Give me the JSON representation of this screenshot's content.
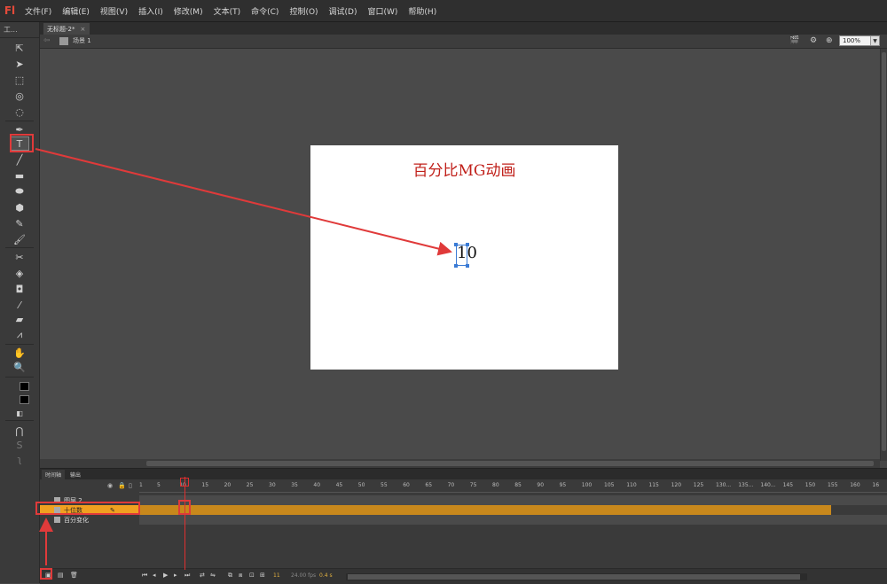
{
  "app": {
    "logo": "Fl"
  },
  "menu": [
    "文件(F)",
    "编辑(E)",
    "视图(V)",
    "插入(I)",
    "修改(M)",
    "文本(T)",
    "命令(C)",
    "控制(O)",
    "调试(D)",
    "窗口(W)",
    "帮助(H)"
  ],
  "toolbar": {
    "header": "工..."
  },
  "document": {
    "tab_title": "无标题-2*",
    "close": "×"
  },
  "editbar": {
    "scene_label": "场景 1",
    "zoom": "100%"
  },
  "stage": {
    "title": "百分比MG动画",
    "text_value": "10"
  },
  "timeline": {
    "tabs": [
      "时间轴",
      "输出"
    ],
    "ruler": [
      "1",
      "5",
      "10",
      "15",
      "20",
      "25",
      "30",
      "35",
      "40",
      "45",
      "50",
      "55",
      "60",
      "65",
      "70",
      "75",
      "80",
      "85",
      "90",
      "95",
      "100",
      "105",
      "110",
      "115",
      "120",
      "125",
      "130...",
      "135...",
      "140...",
      "145",
      "150",
      "155",
      "160",
      "16"
    ],
    "layers": [
      {
        "name": "图层 2"
      },
      {
        "name": "十位数"
      },
      {
        "name": "百分变化"
      }
    ],
    "current_frame": "11",
    "fps": "24.00 fps",
    "time": "0.4 s"
  },
  "colors": {
    "accent": "#e03a3a",
    "layer_selected": "#f0a020",
    "stage_title": "#c0201a"
  }
}
